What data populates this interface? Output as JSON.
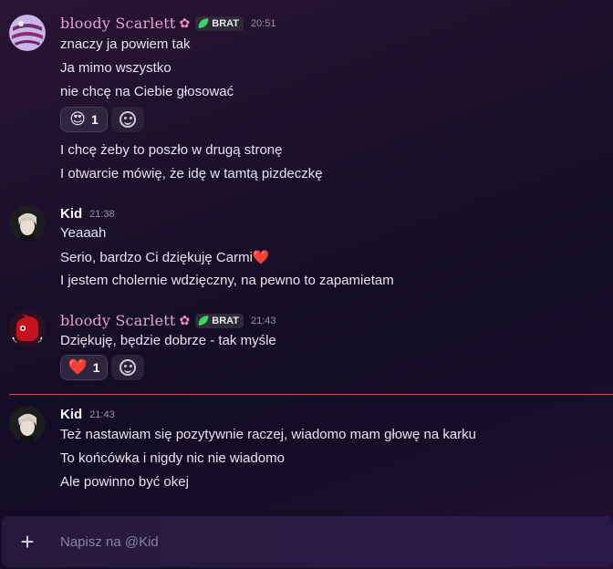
{
  "messages": [
    {
      "user": "bloody Scarlett",
      "tag": "BRAT",
      "time": "20:51",
      "lines": [
        "znaczy ja powiem tak",
        "Ja mimo wszystko",
        "nie chcę na Ciebie głosować"
      ],
      "reaction": {
        "emoji": "😍",
        "count": "1"
      },
      "lines_after": [
        "I chcę żeby to poszło w drugą stronę",
        "I otwarcie mówię, że idę w tamtą pizdeczkę"
      ]
    },
    {
      "user": "Kid",
      "time": "21:38",
      "lines": [
        "Yeaaah",
        "Serio, bardzo Ci dziękuję Carmi❤️",
        "I jestem cholernie wdzięczny, na pewno to zapamietam"
      ]
    },
    {
      "user": "bloody Scarlett",
      "tag": "BRAT",
      "time": "21:43",
      "lines": [
        "Dziękuję, będzie dobrze - tak myśle"
      ],
      "reaction": {
        "emoji": "❤️",
        "count": "1"
      }
    },
    {
      "user": "Kid",
      "time": "21:43",
      "lines": [
        "Też nastawiam się pozytywnie raczej, wiadomo mam głowę na karku",
        "To końcówka i nigdy nic nie wiadomo",
        "Ale powinno być okej"
      ]
    }
  ],
  "composer": {
    "placeholder": "Napisz na @Kid",
    "plus": "+"
  },
  "icons": {
    "flower": "✿",
    "add_reaction": "smiley-icon"
  },
  "colors": {
    "accent_divider": "#d04a5c",
    "tag_leaf": "#3ed26a",
    "scarlett_name": "#e8a0d2"
  }
}
